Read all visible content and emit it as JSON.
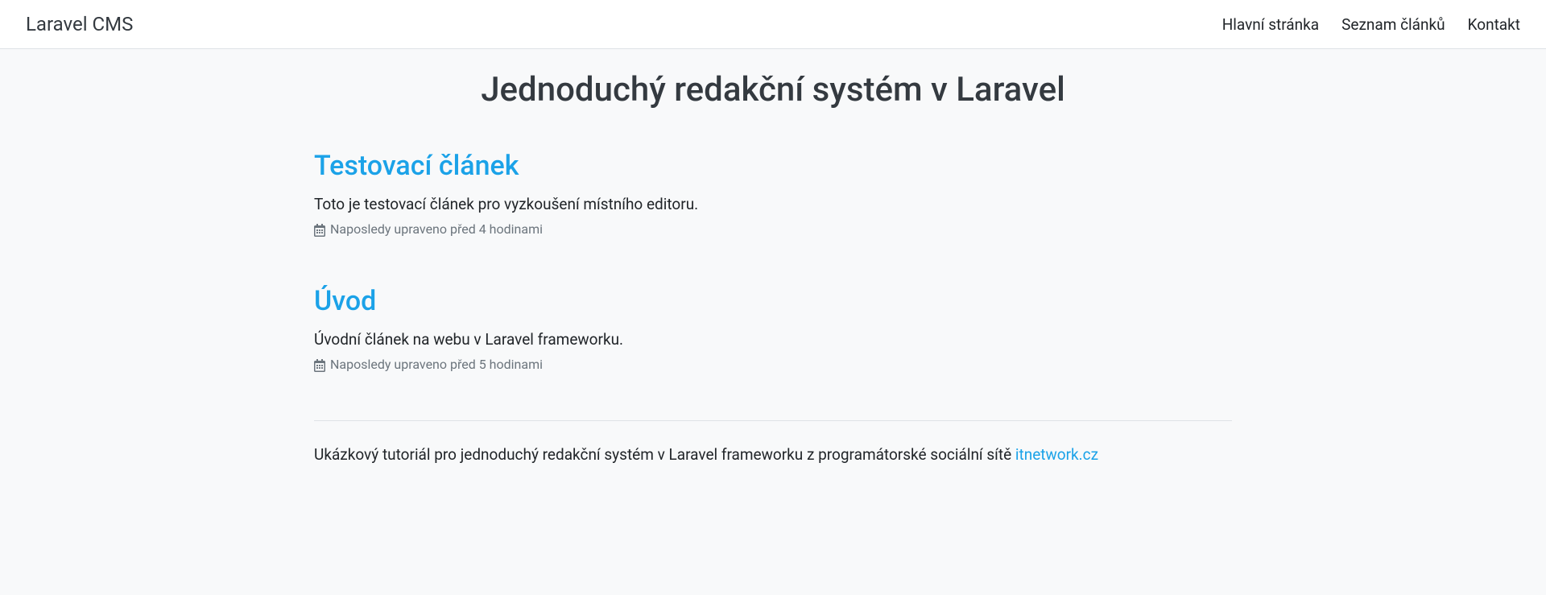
{
  "navbar": {
    "brand": "Laravel CMS",
    "links": [
      "Hlavní stránka",
      "Seznam článků",
      "Kontakt"
    ]
  },
  "page": {
    "title": "Jednoduchý redakční systém v Laravel"
  },
  "articles": [
    {
      "title": "Testovací článek",
      "excerpt": "Toto je testovací článek pro vyzkoušení místního editoru.",
      "meta": "Naposledy upraveno před 4 hodinami"
    },
    {
      "title": "Úvod",
      "excerpt": "Úvodní článek na webu v Laravel frameworku.",
      "meta": "Naposledy upraveno před 5 hodinami"
    }
  ],
  "footer": {
    "text": "Ukázkový tutoriál pro jednoduchý redakční systém v Laravel frameworku z programátorské sociální sítě ",
    "link_text": "itnetwork.cz"
  }
}
